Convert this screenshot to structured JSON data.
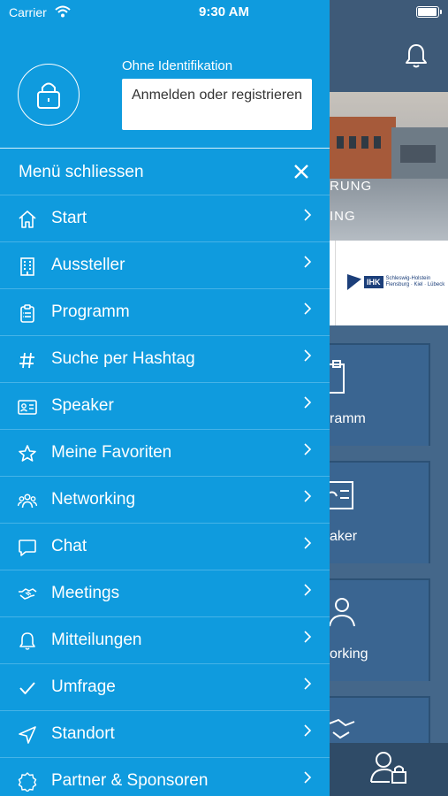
{
  "status_bar": {
    "carrier": "Carrier",
    "time": "9:30 AM",
    "battery_level": 1.0
  },
  "drawer": {
    "identity_label": "Ohne Identifikation",
    "login_button": "Anmelden oder registrieren",
    "close_label": "Menü schliessen",
    "items": [
      {
        "label": "Start",
        "icon": "home-icon"
      },
      {
        "label": "Aussteller",
        "icon": "building-icon"
      },
      {
        "label": "Programm",
        "icon": "clipboard-icon"
      },
      {
        "label": "Suche per Hashtag",
        "icon": "hashtag-icon"
      },
      {
        "label": "Speaker",
        "icon": "id-card-icon"
      },
      {
        "label": "Meine Favoriten",
        "icon": "star-icon"
      },
      {
        "label": "Networking",
        "icon": "people-icon"
      },
      {
        "label": "Chat",
        "icon": "chat-icon"
      },
      {
        "label": "Meetings",
        "icon": "handshake-icon"
      },
      {
        "label": "Mitteilungen",
        "icon": "bell-icon"
      },
      {
        "label": "Umfrage",
        "icon": "checkmark-icon"
      },
      {
        "label": "Standort",
        "icon": "location-arrow-icon"
      },
      {
        "label": "Partner & Sponsoren",
        "icon": "badge-icon"
      }
    ]
  },
  "background": {
    "hero_line1": "RUNG",
    "hero_line2": "ING",
    "sponsor_logo_text": "IHK",
    "sponsor_logo_subtitle": "Schleswig-Holstein",
    "sponsor_logo_cities": "Flensburg · Kiel · Lübeck",
    "tiles": [
      {
        "label": "ramm"
      },
      {
        "label": "aker"
      },
      {
        "label": "orking"
      }
    ]
  },
  "colors": {
    "drawer": "#0f9bde",
    "background": "#44678a",
    "header": "#3e5a78"
  }
}
